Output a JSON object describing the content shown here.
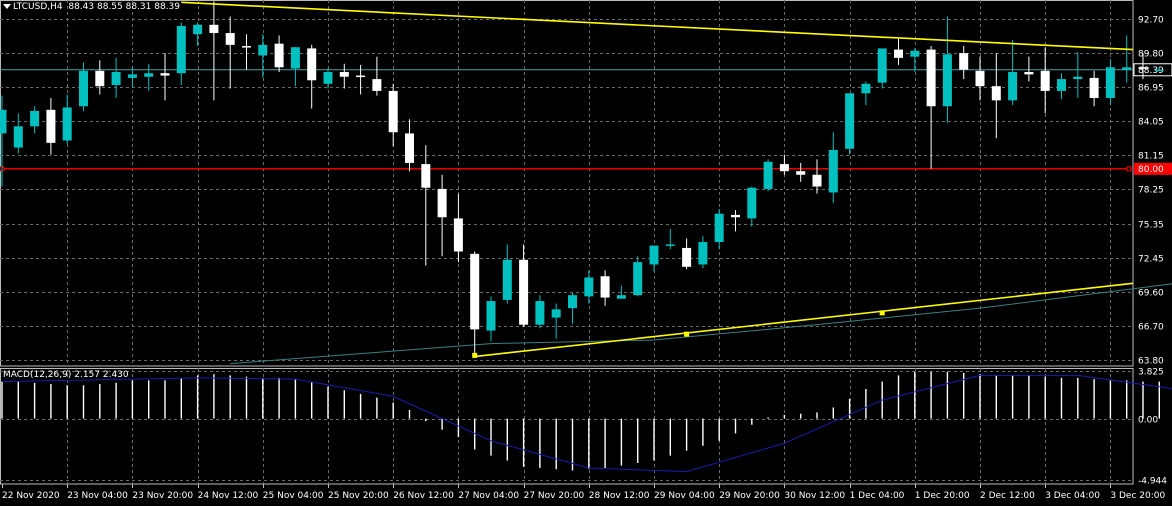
{
  "header": {
    "icon": "triangle-down-icon",
    "symbol": "LTCUSD,H4",
    "ohlc": "88.43 88.55 88.31 88.39"
  },
  "macd": {
    "label": "MACD(12,26,9)",
    "values": "2.157 2.430"
  },
  "colors": {
    "background": "#000000",
    "grid": "#6a6a6a",
    "bull_candle": "#00c0c0",
    "bear_candle": "#ffffff",
    "trendline": "#ffff00",
    "hline": "#ff0000",
    "bid_line": "#4fa0a0",
    "ma_line": "#3c7f7f",
    "signal_line": "#1b1bb0"
  },
  "chart_data": {
    "type": "candlestick",
    "symbol": "LTCUSD",
    "timeframe": "H4",
    "price_axis": {
      "ticks": [
        "92.70",
        "89.80",
        "86.95",
        "84.05",
        "81.15",
        "78.25",
        "75.35",
        "72.45",
        "69.60",
        "66.70",
        "63.80"
      ],
      "range": [
        63.3,
        94.3
      ]
    },
    "time_axis": {
      "labels": [
        "22 Nov 2020",
        "23 Nov 04:00",
        "23 Nov 20:00",
        "24 Nov 12:00",
        "25 Nov 04:00",
        "25 Nov 20:00",
        "26 Nov 12:00",
        "27 Nov 04:00",
        "27 Nov 20:00",
        "28 Nov 12:00",
        "29 Nov 04:00",
        "29 Nov 20:00",
        "30 Nov 12:00",
        "1 Dec 04:00",
        "1 Dec 20:00",
        "2 Dec 12:00",
        "3 Dec 04:00",
        "3 Dec 20:00"
      ]
    },
    "candles": [
      [
        83.0,
        86.2,
        78.5,
        85.0
      ],
      [
        81.8,
        84.7,
        81.3,
        83.6
      ],
      [
        83.6,
        85.3,
        83.0,
        84.9
      ],
      [
        85.0,
        86.0,
        81.2,
        82.2
      ],
      [
        82.4,
        86.3,
        82.1,
        85.2
      ],
      [
        85.3,
        89.0,
        84.9,
        88.3
      ],
      [
        88.3,
        89.2,
        86.3,
        87.0
      ],
      [
        87.1,
        89.4,
        86.0,
        88.2
      ],
      [
        87.7,
        88.6,
        86.9,
        88.0
      ],
      [
        87.8,
        88.9,
        86.6,
        88.1
      ],
      [
        88.1,
        89.8,
        85.8,
        87.9
      ],
      [
        88.1,
        92.4,
        87.1,
        92.1
      ],
      [
        91.4,
        92.4,
        90.4,
        92.2
      ],
      [
        92.2,
        94.2,
        85.8,
        91.5
      ],
      [
        91.5,
        92.9,
        86.8,
        90.5
      ],
      [
        90.4,
        91.4,
        88.4,
        90.3
      ],
      [
        89.6,
        91.4,
        87.7,
        90.5
      ],
      [
        90.6,
        91.3,
        88.2,
        88.6
      ],
      [
        88.5,
        90.3,
        87.0,
        90.3
      ],
      [
        90.2,
        90.5,
        85.1,
        87.5
      ],
      [
        87.2,
        88.5,
        86.8,
        88.2
      ],
      [
        88.2,
        88.9,
        86.8,
        87.8
      ],
      [
        87.9,
        88.8,
        86.3,
        87.8
      ],
      [
        87.6,
        89.5,
        86.2,
        86.6
      ],
      [
        86.6,
        87.2,
        81.9,
        83.1
      ],
      [
        83.0,
        84.2,
        79.8,
        80.5
      ],
      [
        80.4,
        82.0,
        71.8,
        78.4
      ],
      [
        78.3,
        79.5,
        72.6,
        75.9
      ],
      [
        75.8,
        77.9,
        72.1,
        73.0
      ],
      [
        72.8,
        73.0,
        64.1,
        66.4
      ],
      [
        66.3,
        69.2,
        65.4,
        68.8
      ],
      [
        68.9,
        73.6,
        68.6,
        72.3
      ],
      [
        72.3,
        73.6,
        66.6,
        66.8
      ],
      [
        66.8,
        69.3,
        66.5,
        68.8
      ],
      [
        67.4,
        68.6,
        65.6,
        68.1
      ],
      [
        68.2,
        69.5,
        66.9,
        69.3
      ],
      [
        69.2,
        71.4,
        68.6,
        70.8
      ],
      [
        70.9,
        71.4,
        68.4,
        69.1
      ],
      [
        69.0,
        70.1,
        69.0,
        69.3
      ],
      [
        69.3,
        72.6,
        69.2,
        72.1
      ],
      [
        71.9,
        73.3,
        71.3,
        73.5
      ],
      [
        73.5,
        74.9,
        73.2,
        73.6
      ],
      [
        73.3,
        74.1,
        71.5,
        71.7
      ],
      [
        71.9,
        74.3,
        71.6,
        73.8
      ],
      [
        73.8,
        76.6,
        73.2,
        76.2
      ],
      [
        76.1,
        76.5,
        74.7,
        75.9
      ],
      [
        75.8,
        78.5,
        75.1,
        78.4
      ],
      [
        78.3,
        80.8,
        78.1,
        80.6
      ],
      [
        80.4,
        81.2,
        79.5,
        79.8
      ],
      [
        79.8,
        80.5,
        78.9,
        79.5
      ],
      [
        79.5,
        80.8,
        77.9,
        78.5
      ],
      [
        78.0,
        83.1,
        77.1,
        81.6
      ],
      [
        81.7,
        86.4,
        81.2,
        86.4
      ],
      [
        86.4,
        87.4,
        85.4,
        87.2
      ],
      [
        87.3,
        90.1,
        86.8,
        90.2
      ],
      [
        90.1,
        91.0,
        88.8,
        89.4
      ],
      [
        89.5,
        90.2,
        88.2,
        90.0
      ],
      [
        90.1,
        90.4,
        80.0,
        85.3
      ],
      [
        85.3,
        92.9,
        83.9,
        89.7
      ],
      [
        89.8,
        90.4,
        87.6,
        88.4
      ],
      [
        88.3,
        89.5,
        85.8,
        87.0
      ],
      [
        87.0,
        89.8,
        82.6,
        85.8
      ],
      [
        85.8,
        90.9,
        85.4,
        88.2
      ],
      [
        88.2,
        89.5,
        87.4,
        88.0
      ],
      [
        88.3,
        90.3,
        84.7,
        86.6
      ],
      [
        86.6,
        88.1,
        85.9,
        87.6
      ],
      [
        87.6,
        89.9,
        86.0,
        87.8
      ],
      [
        87.7,
        88.3,
        85.3,
        86.0
      ],
      [
        86.0,
        89.3,
        85.4,
        88.6
      ],
      [
        88.4,
        91.3,
        87.3,
        88.6
      ],
      [
        88.6,
        89.8,
        87.6,
        88.5
      ],
      [
        88.4,
        88.6,
        88.3,
        88.4
      ]
    ],
    "horizontal_line": {
      "price": 80.0,
      "label": "80.00"
    },
    "current_price": {
      "price": 88.39,
      "label": "88.39"
    },
    "trendlines": [
      {
        "from": {
          "bar": 11,
          "price": 94.1
        },
        "to": {
          "bar": 72,
          "price": 90.1
        }
      },
      {
        "from": {
          "bar": 29,
          "price": 64.1
        },
        "to": {
          "bar": 72,
          "price": 70.3
        }
      }
    ],
    "trendline_markers": [
      {
        "bar": 29,
        "price": 64.2
      },
      {
        "bar": 42,
        "price": 66.0
      },
      {
        "bar": 54,
        "price": 67.8
      }
    ],
    "moving_average": [
      {
        "bar": 14,
        "price": 63.5
      },
      {
        "bar": 30,
        "price": 65.2
      },
      {
        "bar": 40,
        "price": 65.5
      },
      {
        "bar": 50,
        "price": 66.8
      },
      {
        "bar": 60,
        "price": 68.2
      },
      {
        "bar": 72,
        "price": 70.3
      }
    ],
    "macd_axis": {
      "ticks": [
        "3.825",
        "0.00",
        "-4.944"
      ],
      "range": [
        -5.3,
        4.1
      ]
    },
    "macd_histogram": [
      3.0,
      3.0,
      2.9,
      2.8,
      2.7,
      2.7,
      2.8,
      2.9,
      3.1,
      3.1,
      3.1,
      3.3,
      3.5,
      3.6,
      3.5,
      3.4,
      3.3,
      3.3,
      3.2,
      3.0,
      2.6,
      2.3,
      2.0,
      1.7,
      1.3,
      0.7,
      -0.2,
      -0.9,
      -1.5,
      -2.5,
      -3.0,
      -3.4,
      -3.9,
      -4.0,
      -4.1,
      -4.2,
      -4.1,
      -4.0,
      -3.8,
      -3.6,
      -3.4,
      -3.0,
      -2.6,
      -2.2,
      -1.8,
      -1.2,
      -0.5,
      0.1,
      0.3,
      0.4,
      0.5,
      0.9,
      1.6,
      2.4,
      3.0,
      3.5,
      3.8,
      3.8,
      3.8,
      3.7,
      3.6,
      3.5,
      3.5,
      3.5,
      3.4,
      3.3,
      3.3,
      3.2,
      3.1,
      3.1,
      3.0,
      3.0
    ],
    "macd_signal": [
      {
        "bar": 0,
        "v": 3.0
      },
      {
        "bar": 12,
        "v": 3.3
      },
      {
        "bar": 18,
        "v": 3.2
      },
      {
        "bar": 24,
        "v": 1.8
      },
      {
        "bar": 30,
        "v": -1.8
      },
      {
        "bar": 36,
        "v": -4.0
      },
      {
        "bar": 42,
        "v": -4.3
      },
      {
        "bar": 48,
        "v": -2.0
      },
      {
        "bar": 54,
        "v": 1.5
      },
      {
        "bar": 60,
        "v": 3.5
      },
      {
        "bar": 66,
        "v": 3.5
      },
      {
        "bar": 72,
        "v": 2.4
      }
    ]
  }
}
